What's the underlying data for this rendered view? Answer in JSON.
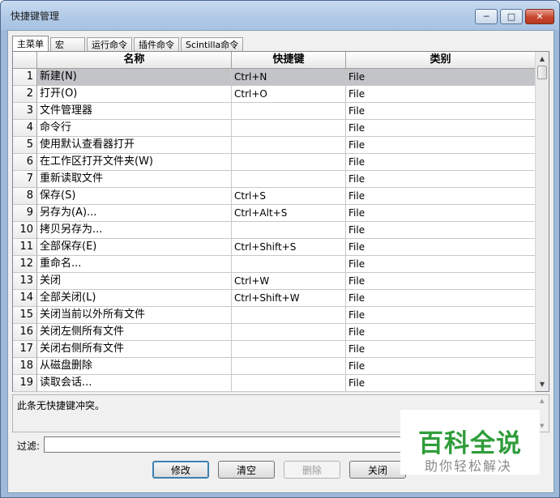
{
  "window": {
    "title": "快捷键管理",
    "min_glyph": "─",
    "max_glyph": "□",
    "close_glyph": "✕"
  },
  "tabs": [
    {
      "label": "主菜单",
      "active": true
    },
    {
      "label": "宏",
      "active": false
    },
    {
      "label": "运行命令",
      "active": false
    },
    {
      "label": "插件命令",
      "active": false
    },
    {
      "label": "Scintilla命令",
      "active": false
    }
  ],
  "table": {
    "headers": {
      "name": "名称",
      "shortcut": "快捷键",
      "category": "类别"
    },
    "selected_row": 1,
    "rows": [
      {
        "num": "1",
        "name": "新建(N)",
        "shortcut": "Ctrl+N",
        "category": "File"
      },
      {
        "num": "2",
        "name": "打开(O)",
        "shortcut": "Ctrl+O",
        "category": "File"
      },
      {
        "num": "3",
        "name": "文件管理器",
        "shortcut": "",
        "category": "File"
      },
      {
        "num": "4",
        "name": "命令行",
        "shortcut": "",
        "category": "File"
      },
      {
        "num": "5",
        "name": "使用默认查看器打开",
        "shortcut": "",
        "category": "File"
      },
      {
        "num": "6",
        "name": "在工作区打开文件夹(W)",
        "shortcut": "",
        "category": "File"
      },
      {
        "num": "7",
        "name": "重新读取文件",
        "shortcut": "",
        "category": "File"
      },
      {
        "num": "8",
        "name": "保存(S)",
        "shortcut": "Ctrl+S",
        "category": "File"
      },
      {
        "num": "9",
        "name": "另存为(A)...",
        "shortcut": "Ctrl+Alt+S",
        "category": "File"
      },
      {
        "num": "10",
        "name": "拷贝另存为...",
        "shortcut": "",
        "category": "File"
      },
      {
        "num": "11",
        "name": "全部保存(E)",
        "shortcut": "Ctrl+Shift+S",
        "category": "File"
      },
      {
        "num": "12",
        "name": "重命名...",
        "shortcut": "",
        "category": "File"
      },
      {
        "num": "13",
        "name": "关闭",
        "shortcut": "Ctrl+W",
        "category": "File"
      },
      {
        "num": "14",
        "name": "全部关闭(L)",
        "shortcut": "Ctrl+Shift+W",
        "category": "File"
      },
      {
        "num": "15",
        "name": "关闭当前以外所有文件",
        "shortcut": "",
        "category": "File"
      },
      {
        "num": "16",
        "name": "关闭左侧所有文件",
        "shortcut": "",
        "category": "File"
      },
      {
        "num": "17",
        "name": "关闭右侧所有文件",
        "shortcut": "",
        "category": "File"
      },
      {
        "num": "18",
        "name": "从磁盘删除",
        "shortcut": "",
        "category": "File"
      },
      {
        "num": "19",
        "name": "读取会话...",
        "shortcut": "",
        "category": "File"
      }
    ]
  },
  "info": {
    "text": "此条无快捷键冲突。"
  },
  "filter": {
    "label": "过滤:",
    "value": ""
  },
  "buttons": {
    "modify": "修改",
    "clear": "清空",
    "delete": "删除",
    "close": "关闭"
  },
  "watermark": {
    "title": "百科全说",
    "subtitle": "助你轻松解决"
  }
}
